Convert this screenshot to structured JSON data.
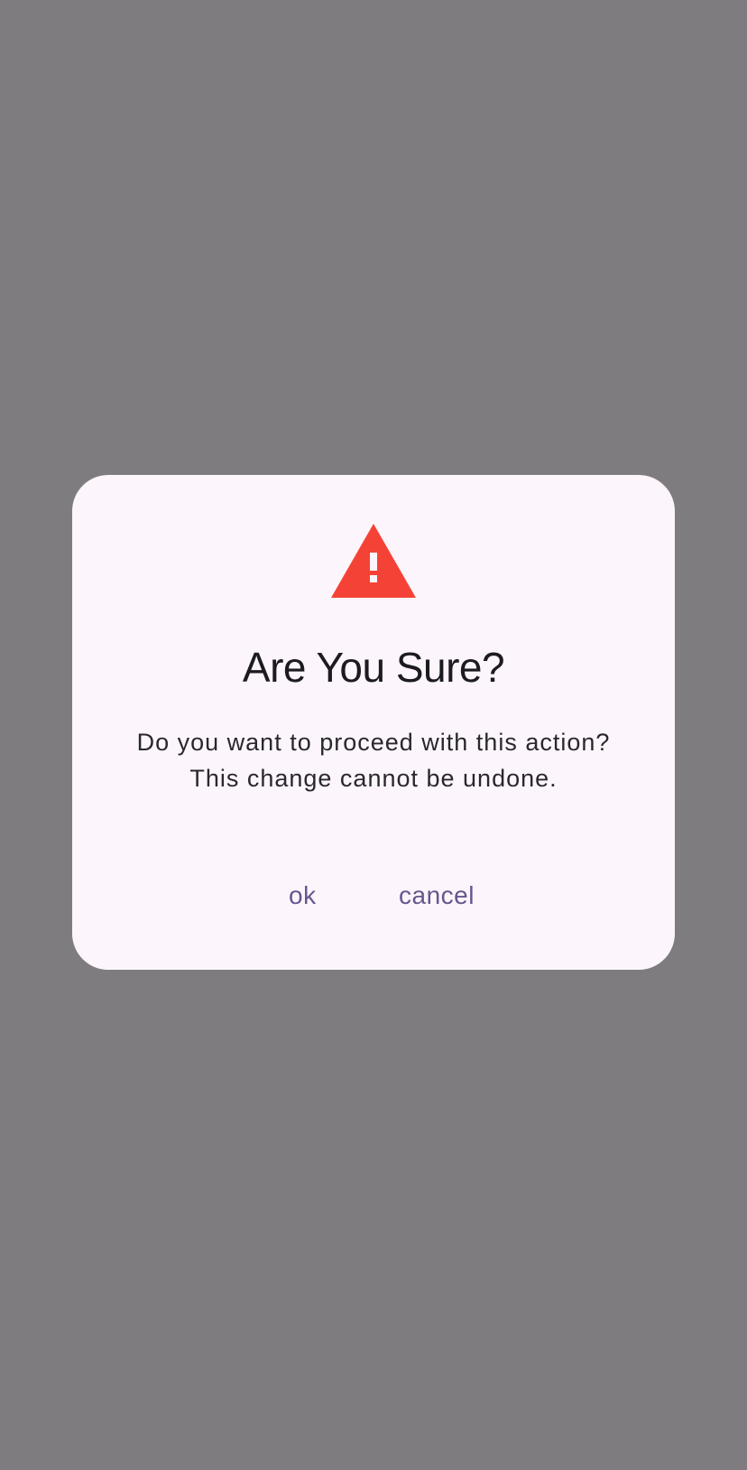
{
  "dialog": {
    "icon": "warning-triangle-icon",
    "icon_color": "#f44336",
    "title": "Are You Sure?",
    "message_line1": "Do you want to proceed with this action?",
    "message_line2": "This change cannot be undone.",
    "ok_label": "ok",
    "cancel_label": "cancel"
  },
  "colors": {
    "scrim": "#7e7c7f",
    "surface": "#fcf6fc",
    "button_text": "#67558e"
  }
}
